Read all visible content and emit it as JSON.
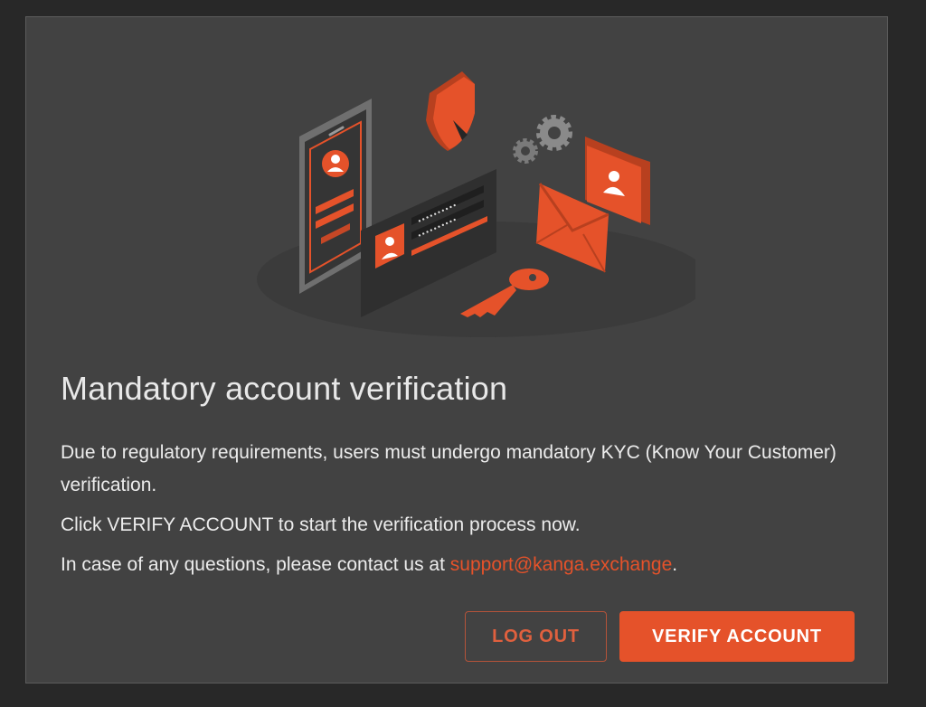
{
  "modal": {
    "title": "Mandatory account verification",
    "paragraph_1": "Due to regulatory requirements, users must undergo mandatory KYC (Know Your Customer) verification.",
    "paragraph_2": "Click VERIFY ACCOUNT to start the verification process now.",
    "paragraph_3_prefix": "In case of any questions, please contact us at ",
    "support_email": "support@kanga.exchange",
    "paragraph_3_suffix": ".",
    "buttons": {
      "logout_label": "LOG OUT",
      "verify_label": "VERIFY ACCOUNT"
    },
    "illustration": {
      "icons": [
        "phone-icon",
        "user-profile-icon",
        "shield-icon",
        "gear-icon",
        "folder-icon",
        "login-card-icon",
        "envelope-icon",
        "key-icon"
      ]
    }
  },
  "colors": {
    "accent": "#e5522a",
    "modal_background": "#424242",
    "page_background": "#282828",
    "text": "#ececec"
  }
}
